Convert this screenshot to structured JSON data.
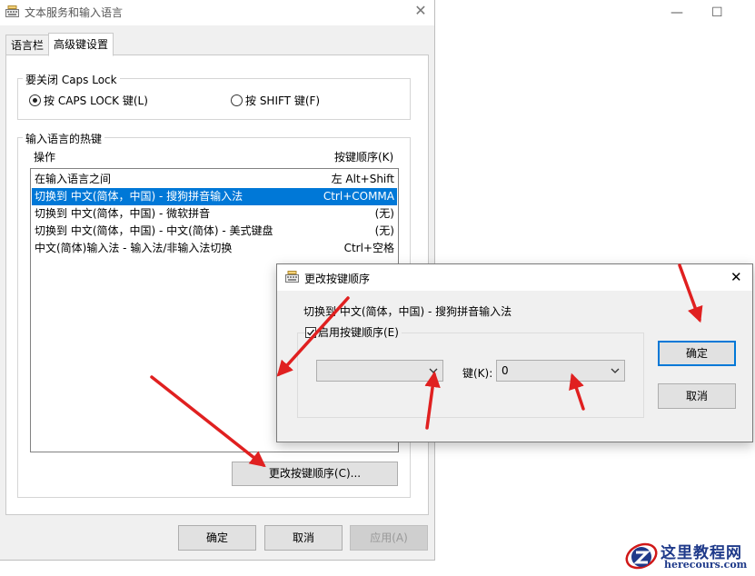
{
  "outer_window": {
    "min_symbol": "—",
    "max_symbol": "☐"
  },
  "main_dialog": {
    "title": "文本服务和输入语言",
    "close_symbol": "✕",
    "tabs": [
      "语言栏",
      "高级键设置"
    ],
    "capslock_group": {
      "label": "要关闭 Caps Lock",
      "option1": "按 CAPS LOCK 键(L)",
      "option2": "按 SHIFT 键(F)",
      "selected": "option1"
    },
    "hotkeys_group": {
      "label": "输入语言的热键",
      "col_action": "操作",
      "col_keys": "按键顺序(K)",
      "rows": [
        {
          "action": "在输入语言之间",
          "keys": "左 Alt+Shift"
        },
        {
          "action": "切换到 中文(简体，中国) - 搜狗拼音输入法",
          "keys": "Ctrl+COMMA"
        },
        {
          "action": "切换到 中文(简体，中国) - 微软拼音",
          "keys": "(无)"
        },
        {
          "action": "切换到 中文(简体，中国) - 中文(简体) - 美式键盘",
          "keys": "(无)"
        },
        {
          "action": "中文(简体)输入法 - 输入法/非输入法切换",
          "keys": "Ctrl+空格"
        }
      ],
      "selected_row": 1,
      "change_button": "更改按键顺序(C)..."
    },
    "buttons": {
      "ok": "确定",
      "cancel": "取消",
      "apply": "应用(A)"
    }
  },
  "change_dialog": {
    "title": "更改按键顺序",
    "close_symbol": "✕",
    "subtitle": "切换到 中文(简体，中国) - 搜狗拼音输入法",
    "enable_label": "启用按键顺序(E)",
    "enable_checked": true,
    "modifier_value": "",
    "key_label": "键(K):",
    "key_value": "0",
    "ok": "确定",
    "cancel": "取消"
  },
  "watermark": {
    "title": "这里教程网",
    "url": "herecours.com"
  },
  "colors": {
    "selection": "#0078d7",
    "arrow": "#e02020",
    "watermark_blue": "#1f3a8a"
  }
}
